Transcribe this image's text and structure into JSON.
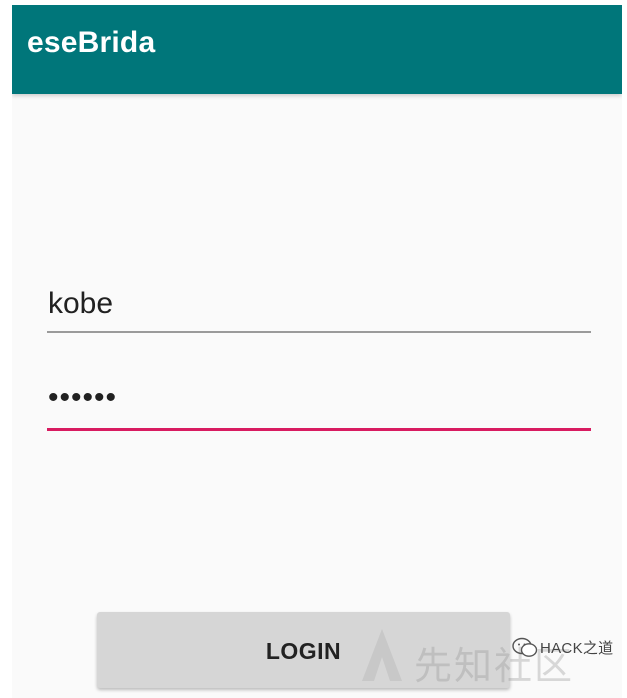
{
  "app": {
    "title": "eseBrida",
    "colors": {
      "appbar": "#00767a",
      "background": "#fafafa",
      "focused_underline": "#d81b60",
      "default_underline": "#9a9a9a",
      "button": "#d6d6d6"
    }
  },
  "form": {
    "username": {
      "value": "kobe"
    },
    "password": {
      "value": "••••••"
    },
    "login_label": "LOGIN"
  },
  "watermark": {
    "cn_text": "先知社区",
    "channel": "HACK之道",
    "icon": "wechat-icon"
  }
}
